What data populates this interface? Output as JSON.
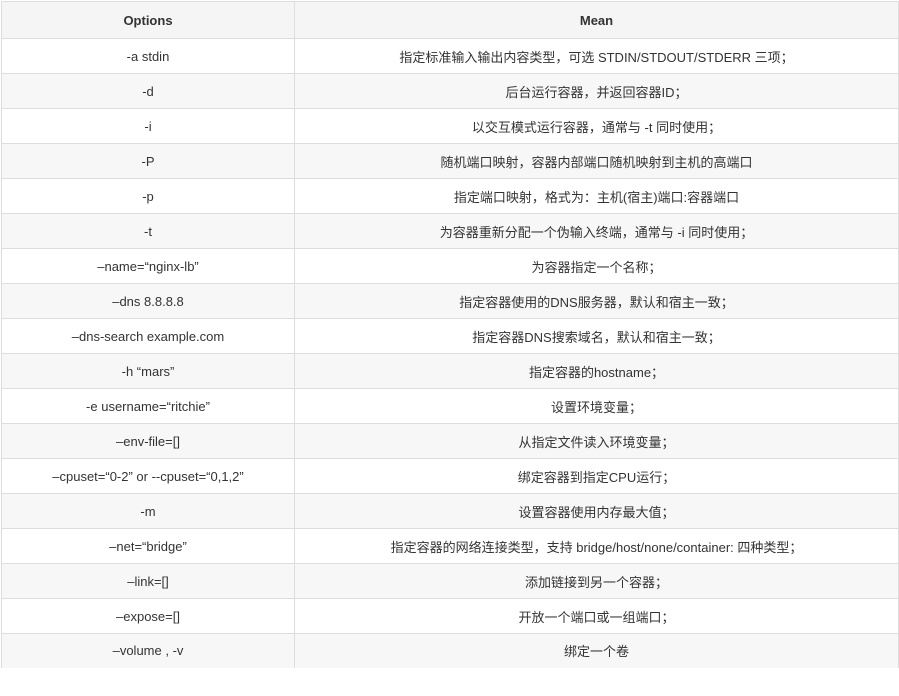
{
  "table": {
    "headers": [
      "Options",
      "Mean"
    ],
    "rows": [
      {
        "option": "-a stdin",
        "mean": "指定标准输入输出内容类型，可选 STDIN/STDOUT/STDERR 三项；"
      },
      {
        "option": "-d",
        "mean": "后台运行容器，并返回容器ID；"
      },
      {
        "option": "-i",
        "mean": "以交互模式运行容器，通常与 -t 同时使用；"
      },
      {
        "option": "-P",
        "mean": "随机端口映射，容器内部端口随机映射到主机的高端口"
      },
      {
        "option": "-p",
        "mean": "指定端口映射，格式为：主机(宿主)端口:容器端口"
      },
      {
        "option": "-t",
        "mean": "为容器重新分配一个伪输入终端，通常与 -i 同时使用；"
      },
      {
        "option": "–name=“nginx-lb”",
        "mean": "为容器指定一个名称；"
      },
      {
        "option": "–dns 8.8.8.8",
        "mean": "指定容器使用的DNS服务器，默认和宿主一致；"
      },
      {
        "option": "–dns-search example.com",
        "mean": "指定容器DNS搜索域名，默认和宿主一致；"
      },
      {
        "option": "-h “mars”",
        "mean": "指定容器的hostname；"
      },
      {
        "option": "-e username=“ritchie”",
        "mean": "设置环境变量；"
      },
      {
        "option": "–env-file=[]",
        "mean": "从指定文件读入环境变量；"
      },
      {
        "option": "–cpuset=“0-2” or --cpuset=“0,1,2”",
        "mean": "绑定容器到指定CPU运行；"
      },
      {
        "option": "-m",
        "mean": "设置容器使用内存最大值；"
      },
      {
        "option": "–net=“bridge”",
        "mean": "指定容器的网络连接类型，支持 bridge/host/none/container: 四种类型；"
      },
      {
        "option": "–link=[]",
        "mean": "添加链接到另一个容器；"
      },
      {
        "option": "–expose=[]",
        "mean": "开放一个端口或一组端口；"
      },
      {
        "option": "–volume , -v",
        "mean": "绑定一个卷"
      }
    ]
  }
}
